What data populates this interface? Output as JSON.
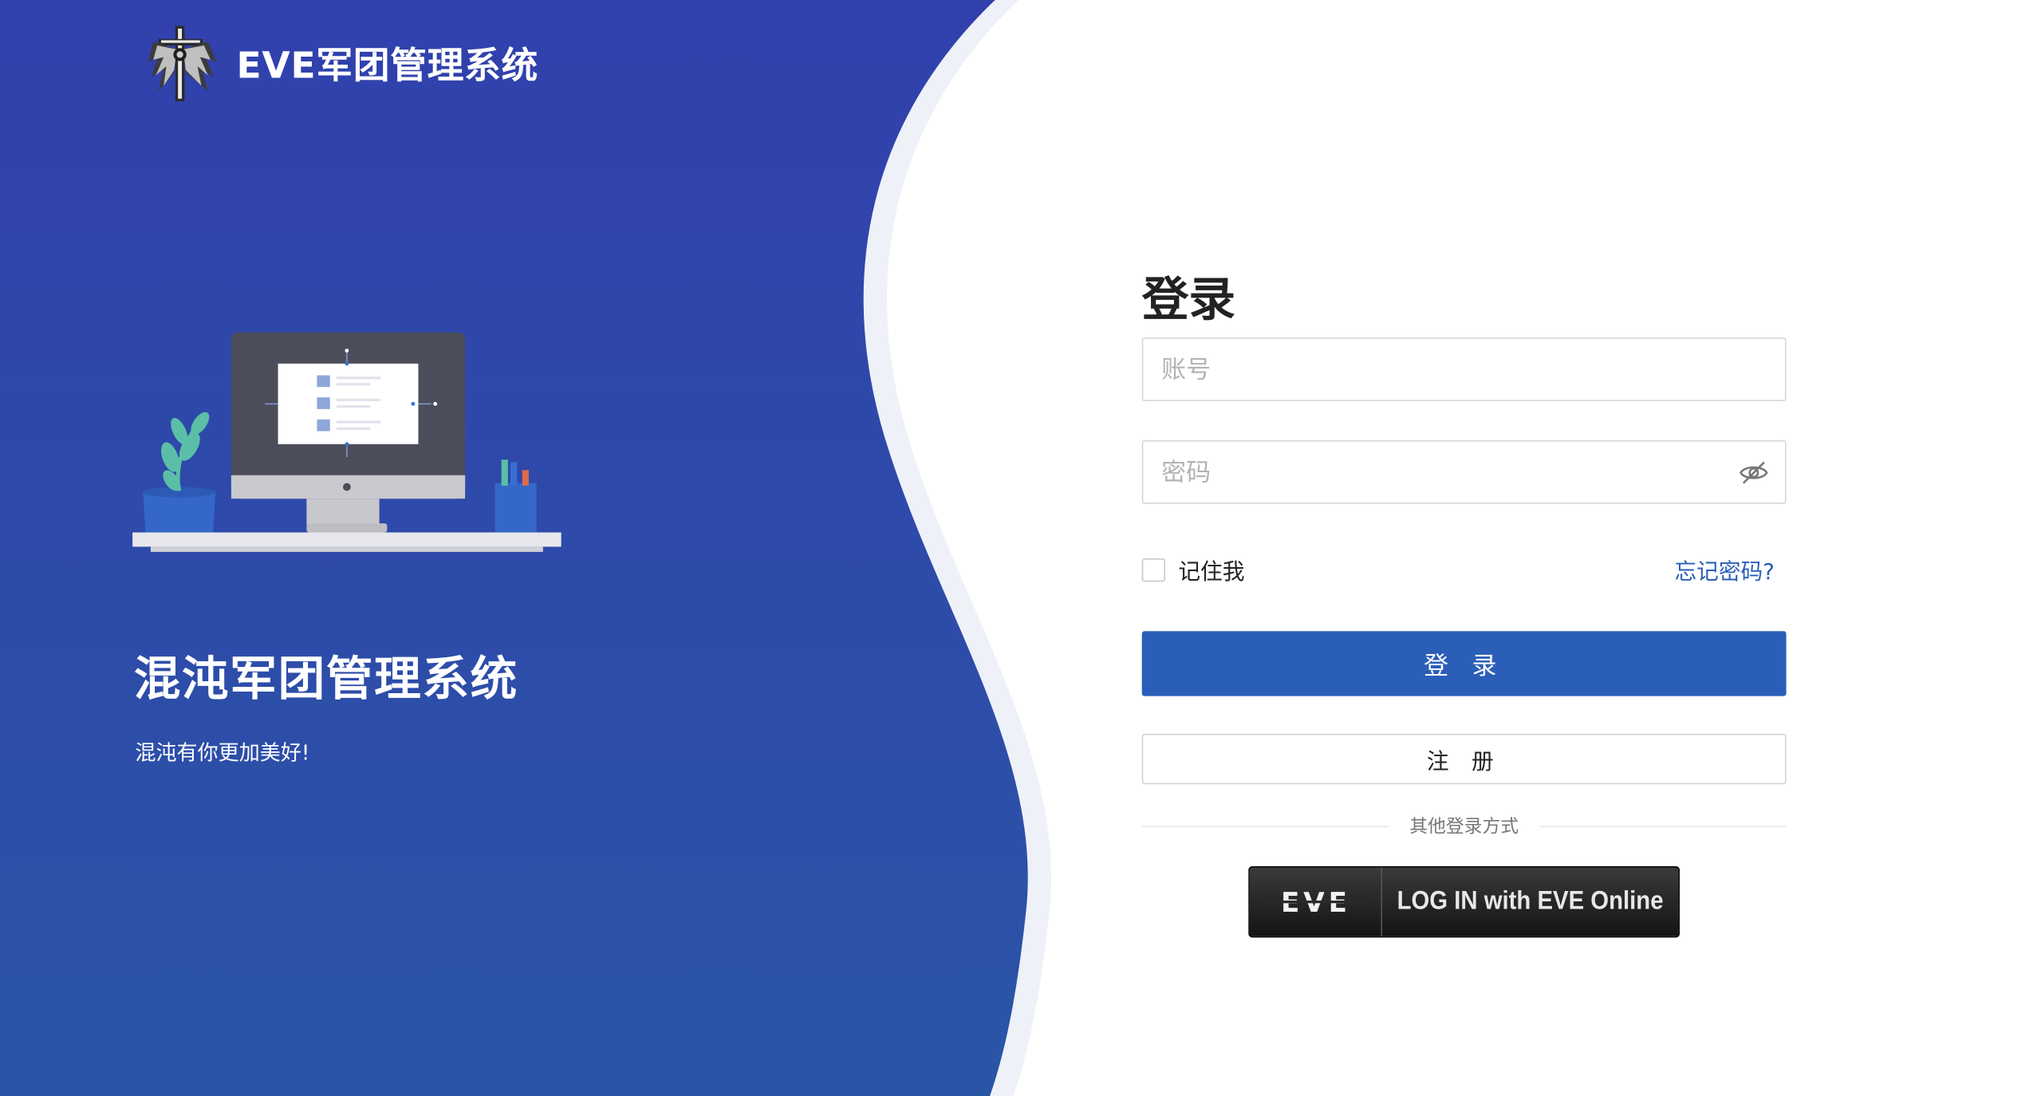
{
  "brand": {
    "title": "EVE军团管理系统",
    "logo_icon": "winged-cross-logo-icon"
  },
  "hero": {
    "title": "混沌军团管理系统",
    "subtitle": "混沌有你更加美好!",
    "illustration": "desktop-computer-illustration"
  },
  "login": {
    "title": "登录",
    "account_placeholder": "账号",
    "account_value": "",
    "password_placeholder": "密码",
    "password_value": "",
    "password_toggle_icon": "eye-slash-icon",
    "remember_label": "记住我",
    "remember_checked": false,
    "forgot_label": "忘记密码?",
    "login_button": "登 录",
    "register_button": "注 册",
    "other_methods_label": "其他登录方式",
    "eve_sso": {
      "logo_text": "EVE",
      "label": "LOG IN with EVE Online"
    }
  },
  "colors": {
    "panel_blue_top": "#3140ad",
    "panel_blue_bottom": "#2a55a6",
    "primary": "#2b5eb8",
    "link": "#2b5eb8",
    "eve_button_dark": "#1c1c1c"
  }
}
